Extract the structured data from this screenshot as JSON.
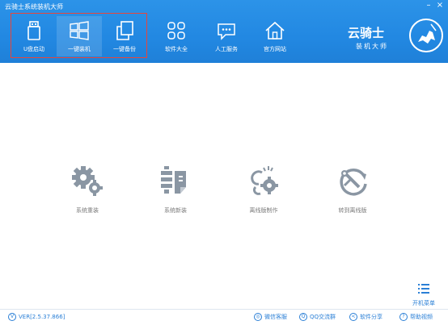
{
  "window": {
    "title": "云骑士系统装机大师",
    "minimize": "–",
    "close": "×"
  },
  "nav": [
    {
      "label": "U盘启动",
      "icon": "usb-drive-icon",
      "active": false
    },
    {
      "label": "一键装机",
      "icon": "windows-icon",
      "active": true
    },
    {
      "label": "一键备份",
      "icon": "copy-icon",
      "active": false
    },
    {
      "label": "软件大全",
      "icon": "apps-grid-icon",
      "active": false
    },
    {
      "label": "人工服务",
      "icon": "chat-icon",
      "active": false
    },
    {
      "label": "官方网站",
      "icon": "home-icon",
      "active": false
    }
  ],
  "brand": {
    "name": "云骑士",
    "tagline": "装机大师"
  },
  "features": [
    {
      "label": "系统重装",
      "icon": "gears-icon"
    },
    {
      "label": "系统新装",
      "icon": "system-install-icon"
    },
    {
      "label": "离线版制作",
      "icon": "offline-make-icon"
    },
    {
      "label": "转到离线版",
      "icon": "switch-offline-icon"
    }
  ],
  "boot_menu": {
    "label": "开机菜单"
  },
  "footer": {
    "version": "VER[2.5.37.866]",
    "links": [
      "微信客服",
      "QQ交流群",
      "软件分享",
      "帮助视频"
    ]
  },
  "colors": {
    "header": "#2288e2",
    "accent": "#2a7fd6",
    "highlight": "#e8463a",
    "feature_icon": "#8a96a3"
  }
}
